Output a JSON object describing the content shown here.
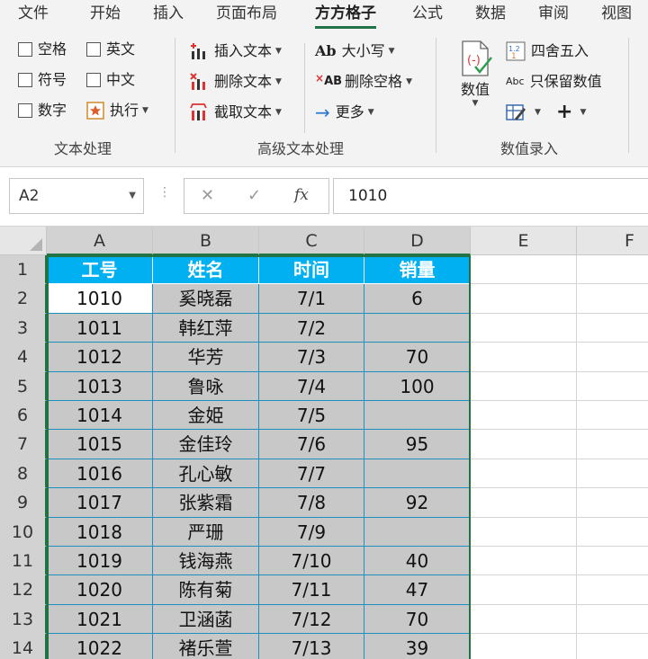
{
  "menu": {
    "tabs": [
      "文件",
      "开始",
      "插入",
      "页面布局",
      "方方格子",
      "公式",
      "数据",
      "审阅",
      "视图"
    ],
    "active_tab": "方方格子"
  },
  "ribbon": {
    "text_processing": {
      "checkboxes": [
        "空格",
        "英文",
        "符号",
        "中文",
        "数字"
      ],
      "execute_label": "执行",
      "group_label": "文本处理"
    },
    "advanced_text": {
      "insert_text": "插入文本",
      "delete_text": "删除文本",
      "extract_text": "截取文本",
      "case_icon": "Ab",
      "case_label": "大小写",
      "delete_spaces_icon": "AB",
      "delete_spaces_label": "删除空格",
      "more_label": "更多",
      "group_label": "高级文本处理"
    },
    "numeric_entry": {
      "value_button": "数值",
      "round_label": "四舍五入",
      "keep_values_icon": "Abc",
      "keep_values_label": "只保留数值",
      "group_label": "数值录入"
    }
  },
  "formula_bar": {
    "name_box": "A2",
    "fx_label": "fx",
    "formula": "1010"
  },
  "sheet": {
    "columns": [
      "A",
      "B",
      "C",
      "D",
      "E",
      "F"
    ],
    "selected_columns": [
      "A",
      "B",
      "C",
      "D"
    ],
    "rows": [
      "1",
      "2",
      "3",
      "4",
      "5",
      "6",
      "7",
      "8",
      "9",
      "10",
      "11",
      "12",
      "13",
      "14"
    ],
    "header": [
      "工号",
      "姓名",
      "时间",
      "销量"
    ],
    "data": [
      [
        "1010",
        "奚晓磊",
        "7/1",
        "6"
      ],
      [
        "1011",
        "韩红萍",
        "7/2",
        ""
      ],
      [
        "1012",
        "华芳",
        "7/3",
        "70"
      ],
      [
        "1013",
        "鲁咏",
        "7/4",
        "100"
      ],
      [
        "1014",
        "金姫",
        "7/5",
        ""
      ],
      [
        "1015",
        "金佳玲",
        "7/6",
        "95"
      ],
      [
        "1016",
        "孔心敏",
        "7/7",
        ""
      ],
      [
        "1017",
        "张紫霜",
        "7/8",
        "92"
      ],
      [
        "1018",
        "严珊",
        "7/9",
        ""
      ],
      [
        "1019",
        "钱海燕",
        "7/10",
        "40"
      ],
      [
        "1020",
        "陈有菊",
        "7/11",
        "47"
      ],
      [
        "1021",
        "卫涵菡",
        "7/12",
        "70"
      ],
      [
        "1022",
        "褚乐萱",
        "7/13",
        "39"
      ]
    ]
  },
  "colors": {
    "header_fill": "#00b0f0",
    "selection_fill": "#c8c8c8",
    "selection_border": "#217346",
    "cell_border": "#1f8fbf"
  }
}
